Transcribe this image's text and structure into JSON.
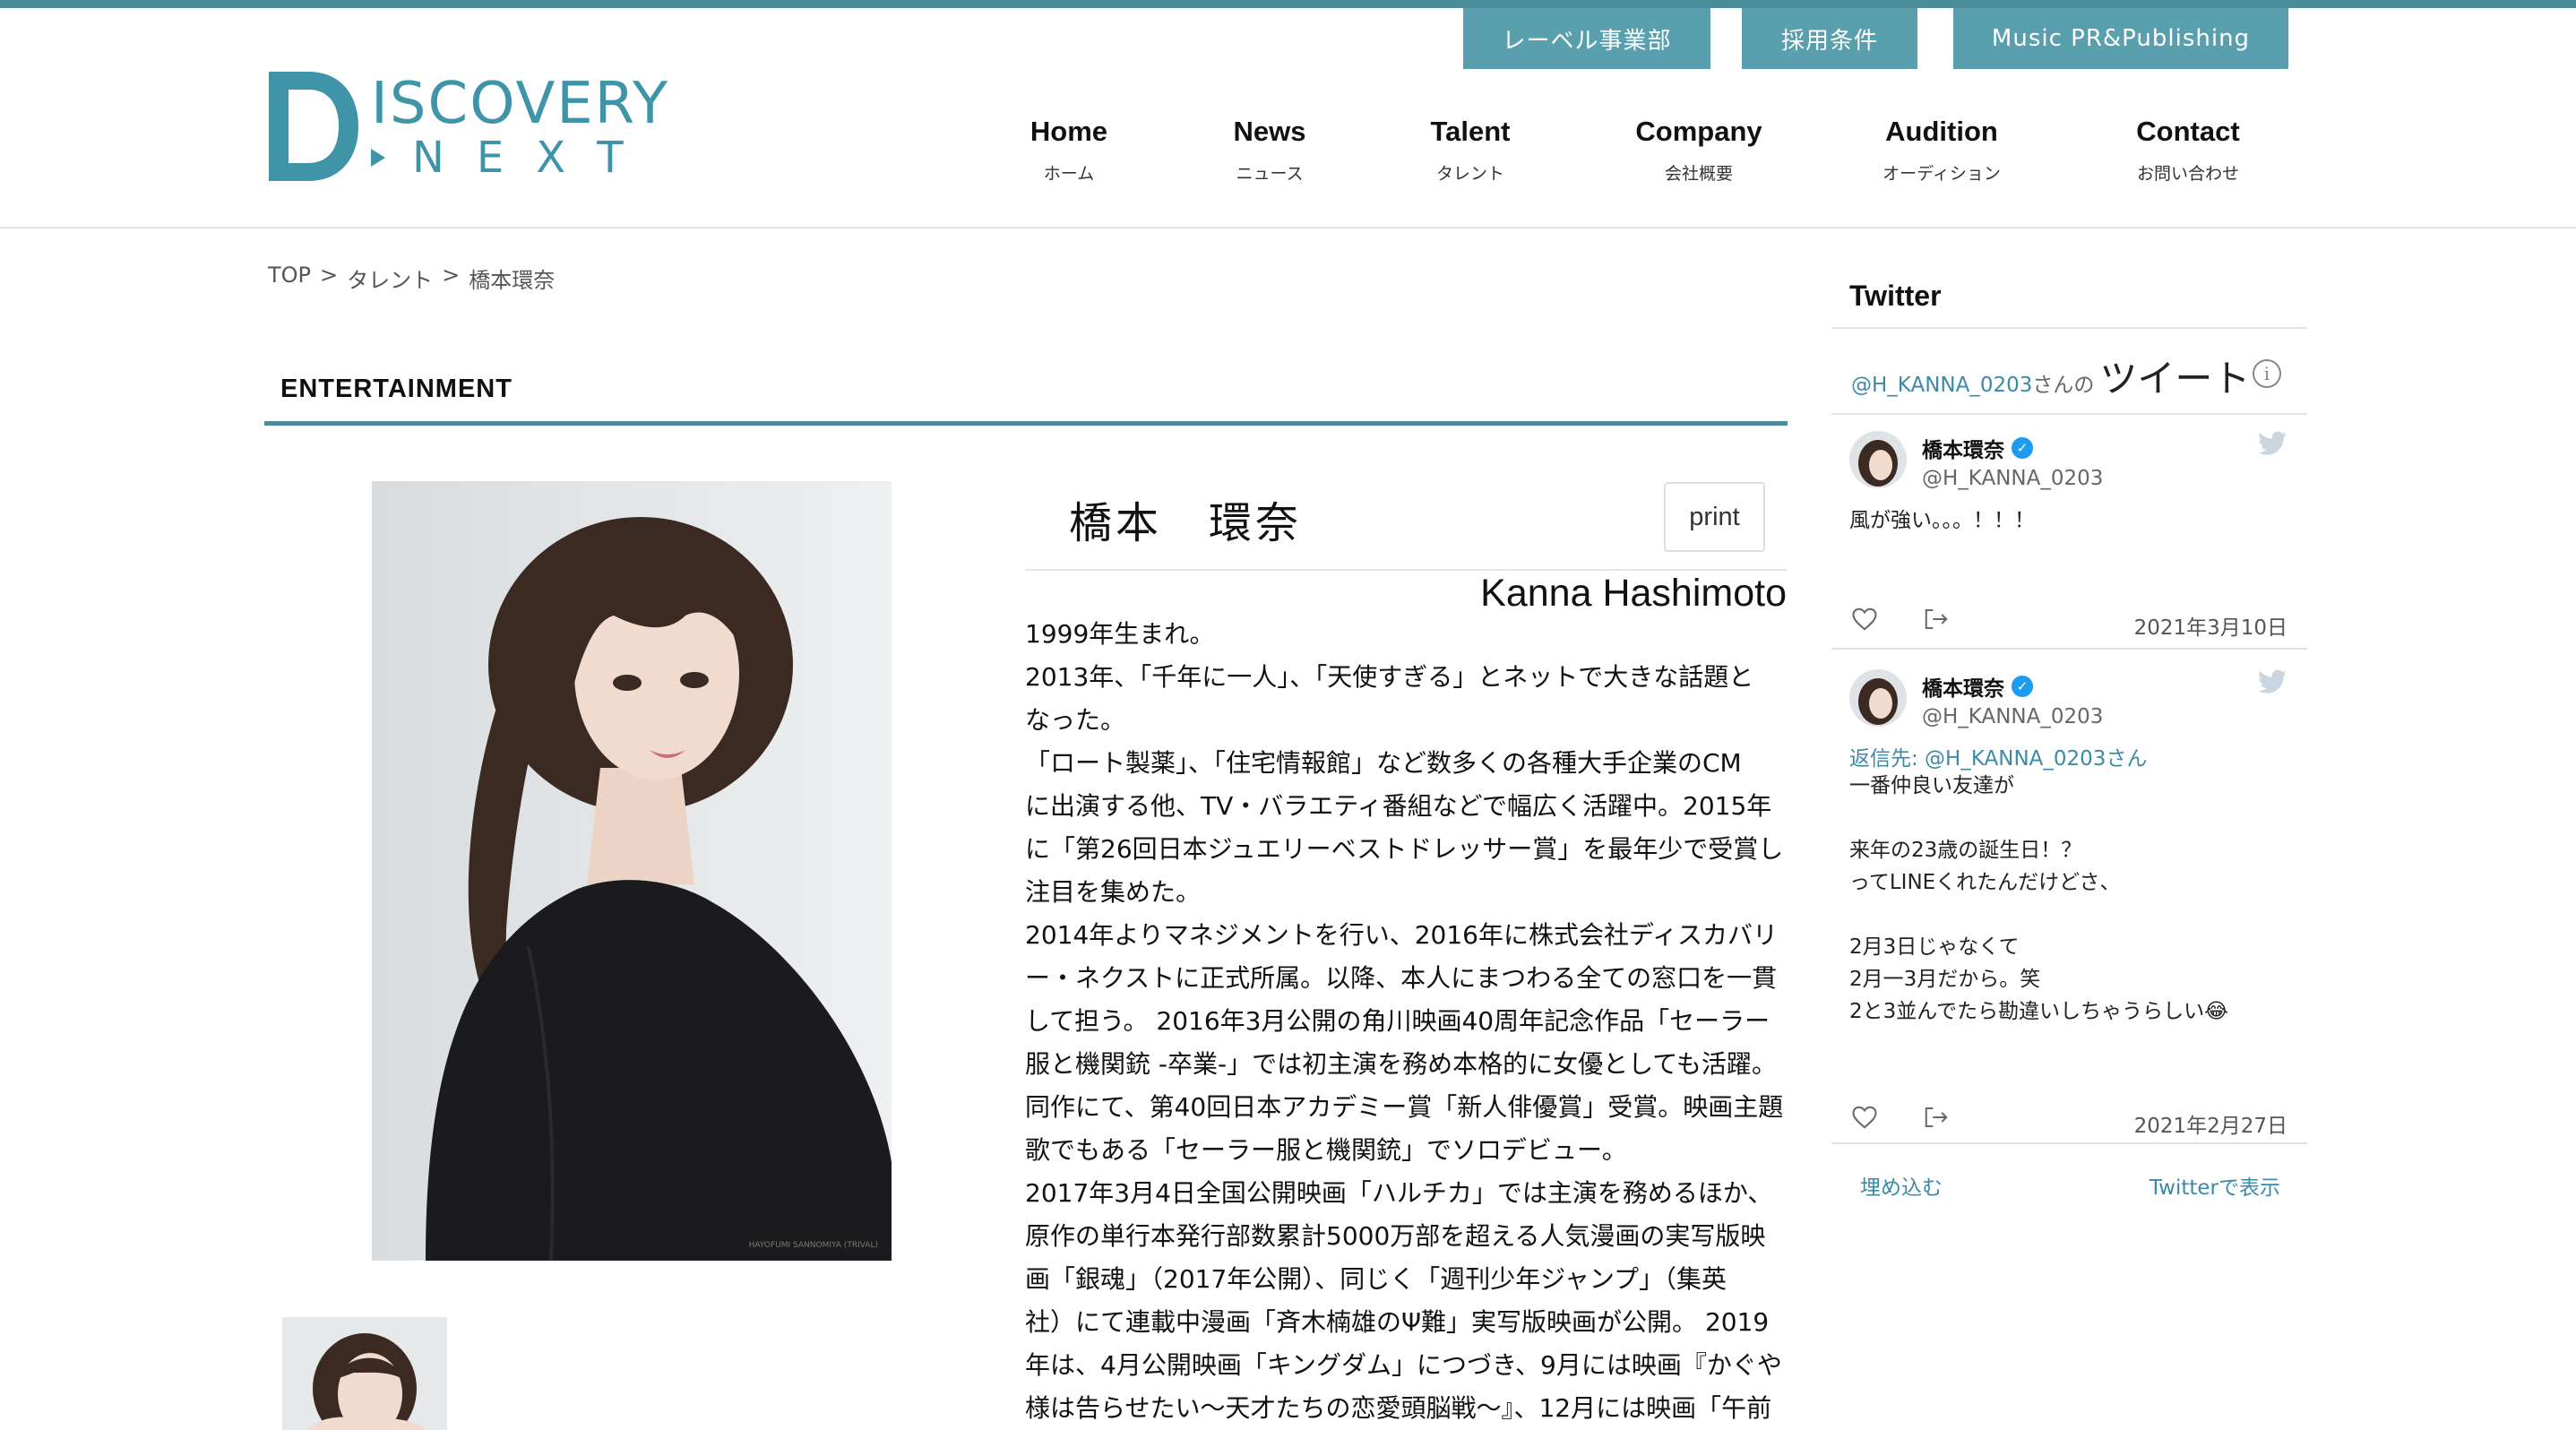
{
  "header": {
    "util_buttons": [
      "レーベル事業部",
      "採用条件",
      "Music PR&Publishing"
    ],
    "logo": {
      "line1": "ISCOVERY",
      "line2": "NEXT"
    },
    "nav": [
      {
        "en": "Home",
        "jp": "ホーム"
      },
      {
        "en": "News",
        "jp": "ニュース"
      },
      {
        "en": "Talent",
        "jp": "タレント"
      },
      {
        "en": "Company",
        "jp": "会社概要"
      },
      {
        "en": "Audition",
        "jp": "オーディション"
      },
      {
        "en": "Contact",
        "jp": "お問い合わせ"
      }
    ]
  },
  "breadcrumb": {
    "items": [
      "TOP",
      "タレント",
      "橋本環奈"
    ],
    "separator": ">"
  },
  "section": {
    "title": "ENTERTAINMENT"
  },
  "profile": {
    "name_jp": "橋本　環奈",
    "name_en": "Kanna Hashimoto",
    "print_label": "print",
    "photo_credit": "HAYOFUMI SANNOMIYA (TRIVAL)",
    "bio_lines": [
      "1999年生まれ。",
      "2013年、「千年に一人」、「天使すぎる」とネットで大きな話題と",
      "なった。",
      "「ロート製薬」、「住宅情報館」など数多くの各種大手企業のCM",
      "に出演する他、TV・バラエティ番組などで幅広く活躍中。2015年",
      "に「第26回日本ジュエリーベストドレッサー賞」を最年少で受賞し",
      "注目を集めた。",
      "2014年よりマネジメントを行い、2016年に株式会社ディスカバリ",
      "ー・ネクストに正式所属。以降、本人にまつわる全ての窓口を一貫",
      "して担う。 2016年3月公開の角川映画40周年記念作品「セーラー",
      "服と機関銃 -卒業-」では初主演を務め本格的に女優としても活躍。",
      "同作にて、第40回日本アカデミー賞「新人俳優賞」受賞。映画主題",
      "歌でもある「セーラー服と機関銃」でソロデビュー。",
      "2017年3月4日全国公開映画「ハルチカ」では主演を務めるほか、",
      "原作の単行本発行部数累計5000万部を超える人気漫画の実写版映",
      "画「銀魂」（2017年公開）、同じく「週刊少年ジャンプ」（集英",
      "社）にて連載中漫画「斉木楠雄のΨ難」実写版映画が公開。 2019",
      "年は、4月公開映画「キングダム」につづき、9月には映画『かぐや",
      "様は告らせたい～天才たちの恋愛頭脳戦～』、12月には映画「午前"
    ]
  },
  "twitter": {
    "title": "Twitter",
    "handle_link": "@H_KANNA_0203",
    "handle_suffix": "さんの",
    "tweets_word": "ツイート",
    "info_icon": "i",
    "tweets": [
      {
        "name": "橋本環奈",
        "handle": "@H_KANNA_0203",
        "reply_to": "",
        "lines": [
          "風が強い。。。！！！"
        ],
        "date": "2021年3月10日"
      },
      {
        "name": "橋本環奈",
        "handle": "@H_KANNA_0203",
        "reply_to": "返信先: @H_KANNA_0203さん",
        "lines": [
          "一番仲良い友達が",
          "",
          "来年の23歳の誕生日！？",
          "ってLINEくれたんだけどさ、",
          "",
          "2月3日じゃなくて",
          "2月一3月だから。笑",
          "2と3並んでたら勘違いしちゃうらしい😂"
        ],
        "date": "2021年2月27日"
      }
    ],
    "embed_label": "埋め込む",
    "view_label": "Twitterで表示"
  },
  "colors": {
    "brand_teal": "#4a8c9a",
    "button_teal": "#5a9fad",
    "link_blue": "#3a8aa8",
    "verified_blue": "#1d9bf0"
  }
}
